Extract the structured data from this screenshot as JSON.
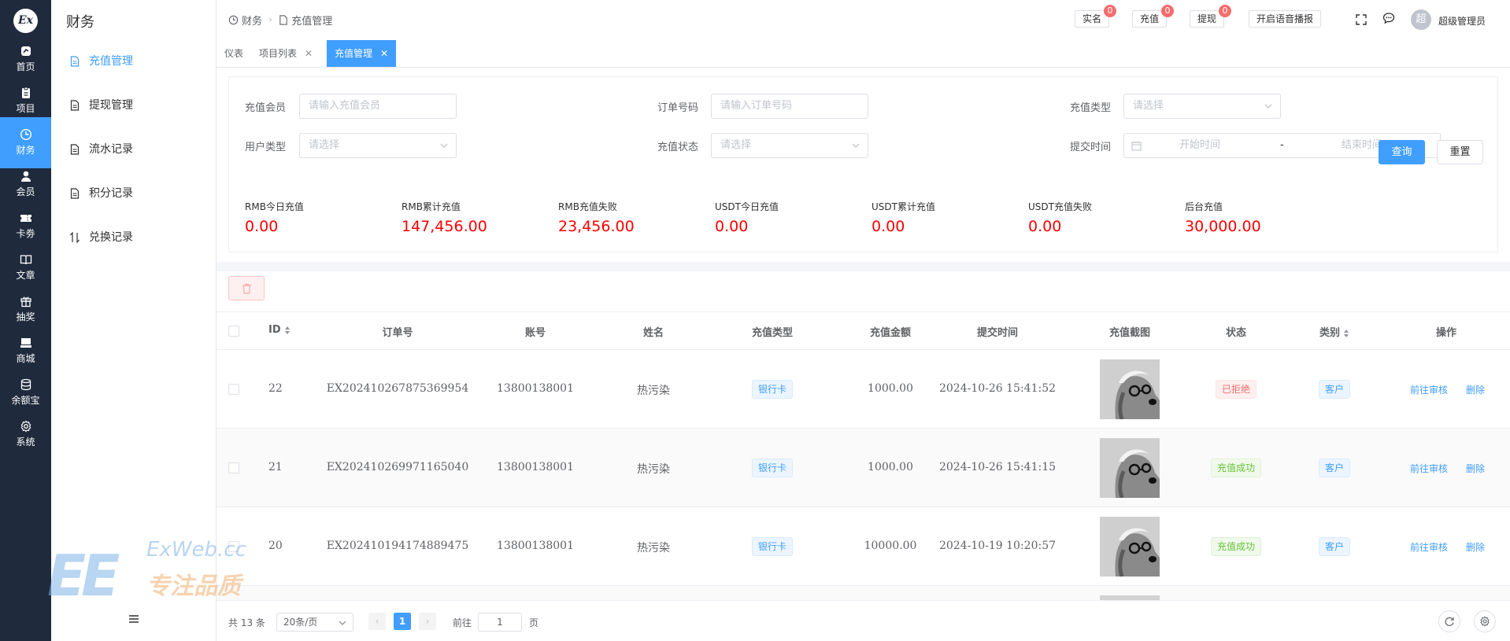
{
  "rail": {
    "logo": "Ex",
    "items": [
      {
        "label": "首页",
        "icon": "chart-icon"
      },
      {
        "label": "项目",
        "icon": "clipboard-icon"
      },
      {
        "label": "财务",
        "icon": "clock-icon"
      },
      {
        "label": "会员",
        "icon": "user-icon"
      },
      {
        "label": "卡劵",
        "icon": "ticket-icon"
      },
      {
        "label": "文章",
        "icon": "book-icon"
      },
      {
        "label": "抽奖",
        "icon": "gift-icon"
      },
      {
        "label": "商城",
        "icon": "shop-icon"
      },
      {
        "label": "余额宝",
        "icon": "database-icon"
      },
      {
        "label": "系统",
        "icon": "gear-icon"
      }
    ],
    "active_index": 2
  },
  "submenu": {
    "title": "财务",
    "items": [
      {
        "label": "充值管理",
        "icon": "document-icon"
      },
      {
        "label": "提现管理",
        "icon": "document-icon"
      },
      {
        "label": "流水记录",
        "icon": "document-icon"
      },
      {
        "label": "积分记录",
        "icon": "document-icon"
      },
      {
        "label": "兑换记录",
        "icon": "swap-icon"
      }
    ],
    "active_index": 0
  },
  "header": {
    "breadcrumb": [
      "财务",
      "充值管理"
    ],
    "buttons": [
      {
        "label": "实名",
        "badge": "0"
      },
      {
        "label": "充值",
        "badge": "0"
      },
      {
        "label": "提现",
        "badge": "0"
      }
    ],
    "voice_label": "开启语音播报",
    "avatar_text": "超",
    "username": "超级管理员"
  },
  "tabs": [
    {
      "label": "仪表"
    },
    {
      "label": "项目列表"
    },
    {
      "label": "充值管理"
    }
  ],
  "filters": {
    "member_label": "充值会员",
    "member_placeholder": "请输入充值会员",
    "order_label": "订单号码",
    "order_placeholder": "请输入订单号码",
    "type_label": "充值类型",
    "type_placeholder": "请选择",
    "usertype_label": "用户类型",
    "usertype_placeholder": "请选择",
    "status_label": "充值状态",
    "status_placeholder": "请选择",
    "time_label": "提交时间",
    "time_start": "开始时间",
    "time_sep": "-",
    "time_end": "结束时间",
    "query_label": "查询",
    "reset_label": "重置"
  },
  "stats": [
    {
      "label": "RMB今日充值",
      "value": "0.00"
    },
    {
      "label": "RMB累计充值",
      "value": "147,456.00"
    },
    {
      "label": "RMB充值失败",
      "value": "23,456.00"
    },
    {
      "label": "USDT今日充值",
      "value": "0.00"
    },
    {
      "label": "USDT累计充值",
      "value": "0.00"
    },
    {
      "label": "USDT充值失败",
      "value": "0.00"
    },
    {
      "label": "后台充值",
      "value": "30,000.00"
    }
  ],
  "table": {
    "headers": [
      "ID",
      "订单号",
      "账号",
      "姓名",
      "充值类型",
      "充值金额",
      "提交时间",
      "充值截图",
      "状态",
      "类别",
      "操作"
    ],
    "rows": [
      {
        "id": "22",
        "order": "EX202410267875369954",
        "account": "13800138001",
        "name": "热污染",
        "type": "银行卡",
        "amount": "1000.00",
        "time": "2024-10-26 15:41:52",
        "status": "已拒绝",
        "category": "客户",
        "review": "前往审核",
        "delete": "删除"
      },
      {
        "id": "21",
        "order": "EX202410269971165040",
        "account": "13800138001",
        "name": "热污染",
        "type": "银行卡",
        "amount": "1000.00",
        "time": "2024-10-26 15:41:15",
        "status": "充值成功",
        "category": "客户",
        "review": "前往审核",
        "delete": "删除"
      },
      {
        "id": "20",
        "order": "EX202410194174889475",
        "account": "13800138001",
        "name": "热污染",
        "type": "银行卡",
        "amount": "10000.00",
        "time": "2024-10-19 10:20:57",
        "status": "充值成功",
        "category": "客户",
        "review": "前往审核",
        "delete": "删除"
      }
    ]
  },
  "pager": {
    "total": "共 13 条",
    "page_size": "20条/页",
    "current_page": "1",
    "goto_label": "前往",
    "goto_value": "1",
    "page_suffix": "页"
  },
  "watermark": {
    "text1": "ExWeb.cc",
    "text2": "专注品质",
    "mark": "EE"
  },
  "colors": {
    "accent": "#409eff",
    "rail": "#1f2a3d",
    "danger": "#ff0000",
    "success": "#67c23a"
  }
}
